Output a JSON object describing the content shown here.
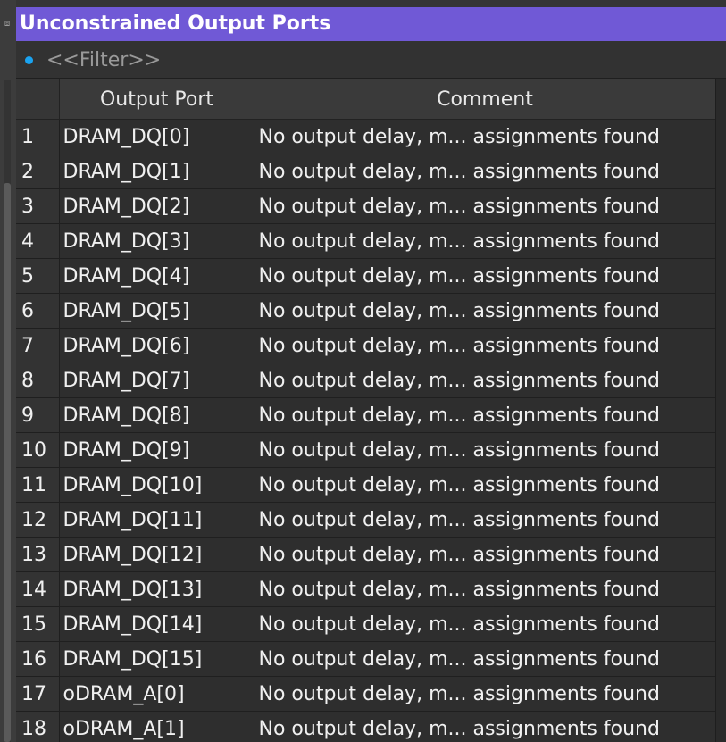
{
  "panel": {
    "title": "Unconstrained Output Ports"
  },
  "filter": {
    "placeholder": "<<Filter>>",
    "indicator_color": "#1aa3f0"
  },
  "table": {
    "columns": [
      "",
      "Output Port",
      "Comment"
    ],
    "rows": [
      {
        "index": "1",
        "port": "DRAM_DQ[0]",
        "comment": "No output delay, m... assignments found"
      },
      {
        "index": "2",
        "port": "DRAM_DQ[1]",
        "comment": "No output delay, m... assignments found"
      },
      {
        "index": "3",
        "port": "DRAM_DQ[2]",
        "comment": "No output delay, m... assignments found"
      },
      {
        "index": "4",
        "port": "DRAM_DQ[3]",
        "comment": "No output delay, m... assignments found"
      },
      {
        "index": "5",
        "port": "DRAM_DQ[4]",
        "comment": "No output delay, m... assignments found"
      },
      {
        "index": "6",
        "port": "DRAM_DQ[5]",
        "comment": "No output delay, m... assignments found"
      },
      {
        "index": "7",
        "port": "DRAM_DQ[6]",
        "comment": "No output delay, m... assignments found"
      },
      {
        "index": "8",
        "port": "DRAM_DQ[7]",
        "comment": "No output delay, m... assignments found"
      },
      {
        "index": "9",
        "port": "DRAM_DQ[8]",
        "comment": "No output delay, m... assignments found"
      },
      {
        "index": "10",
        "port": "DRAM_DQ[9]",
        "comment": "No output delay, m... assignments found"
      },
      {
        "index": "11",
        "port": "DRAM_DQ[10]",
        "comment": "No output delay, m... assignments found"
      },
      {
        "index": "12",
        "port": "DRAM_DQ[11]",
        "comment": "No output delay, m... assignments found"
      },
      {
        "index": "13",
        "port": "DRAM_DQ[12]",
        "comment": "No output delay, m... assignments found"
      },
      {
        "index": "14",
        "port": "DRAM_DQ[13]",
        "comment": "No output delay, m... assignments found"
      },
      {
        "index": "15",
        "port": "DRAM_DQ[14]",
        "comment": "No output delay, m... assignments found"
      },
      {
        "index": "16",
        "port": "DRAM_DQ[15]",
        "comment": "No output delay, m... assignments found"
      },
      {
        "index": "17",
        "port": "oDRAM_A[0]",
        "comment": "No output delay, m... assignments found"
      },
      {
        "index": "18",
        "port": "oDRAM_A[1]",
        "comment": "No output delay, m... assignments found"
      }
    ]
  },
  "colors": {
    "title_bar": "#7059d6",
    "background": "#2e2e2e",
    "text": "#f0f0f0"
  }
}
